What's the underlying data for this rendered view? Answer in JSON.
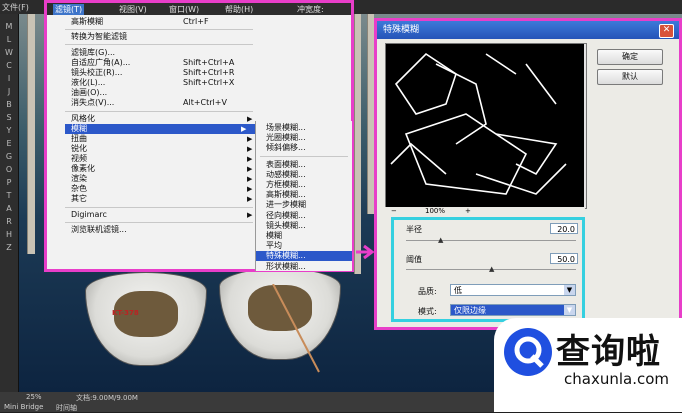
{
  "topbar": {
    "file_menu": "文件(F)"
  },
  "tools": [
    "M",
    "L",
    "W",
    "C",
    "I",
    "J",
    "B",
    "S",
    "Y",
    "E",
    "G",
    "O",
    "P",
    "T",
    "A",
    "R",
    "H",
    "Z"
  ],
  "status": {
    "zoom": "25%",
    "doc": "文档:9.00M/9.00M",
    "panel_tab1": "Mini Bridge",
    "panel_tab2": "时间轴"
  },
  "canvas": {
    "boat_label": "KT-378"
  },
  "menubar": {
    "filter": "滤镜(T)",
    "view": "视图(V)",
    "window": "窗口(W)",
    "help": "帮助(H)",
    "partial_right": "冲宽度:"
  },
  "menu": {
    "last_filter": {
      "label": "高斯模糊",
      "shortcut": "Ctrl+F"
    },
    "convert_smart": "转换为智能滤镜",
    "gallery": "滤镜库(G)...",
    "adaptive_wide": {
      "label": "自适应广角(A)...",
      "shortcut": "Shift+Ctrl+A"
    },
    "lens_correction": {
      "label": "镜头校正(R)...",
      "shortcut": "Shift+Ctrl+R"
    },
    "liquify": {
      "label": "液化(L)...",
      "shortcut": "Shift+Ctrl+X"
    },
    "oil_paint": "油画(O)...",
    "vanishing_point": {
      "label": "消失点(V)...",
      "shortcut": "Alt+Ctrl+V"
    },
    "stylize": "风格化",
    "blur": "模糊",
    "distort": "扭曲",
    "sharpen": "锐化",
    "video": "视频",
    "pixelate": "像素化",
    "render": "渲染",
    "noise": "杂色",
    "other": "其它",
    "digimarc": "Digimarc",
    "browse_online": "浏览联机滤镜...",
    "arrow": "▶"
  },
  "submenu": [
    "场景模糊...",
    "光圈模糊...",
    "倾斜偏移...",
    "表面模糊...",
    "动感模糊...",
    "方框模糊...",
    "高斯模糊...",
    "进一步模糊",
    "径向模糊...",
    "镜头模糊...",
    "模糊",
    "平均",
    "特殊模糊...",
    "形状模糊..."
  ],
  "dialog": {
    "title": "特殊模糊",
    "close": "✕",
    "ok": "确定",
    "default": "默认",
    "zoom": "100%",
    "zoom_minus": "−",
    "zoom_plus": "+",
    "radius_label": "半径",
    "radius_value": "20.0",
    "threshold_label": "阈值",
    "threshold_value": "50.0",
    "quality_label": "品质:",
    "quality_value": "低",
    "mode_label": "模式:",
    "mode_value": "仅限边缘",
    "radius_pos": 0.2,
    "threshold_pos": 0.5
  },
  "watermark": {
    "cn": "查询啦",
    "en": "chaxunla.com"
  },
  "colors": {
    "highlight": "#e83ec9",
    "params_box": "#35d0e0",
    "menu_select": "#2c58c9"
  }
}
